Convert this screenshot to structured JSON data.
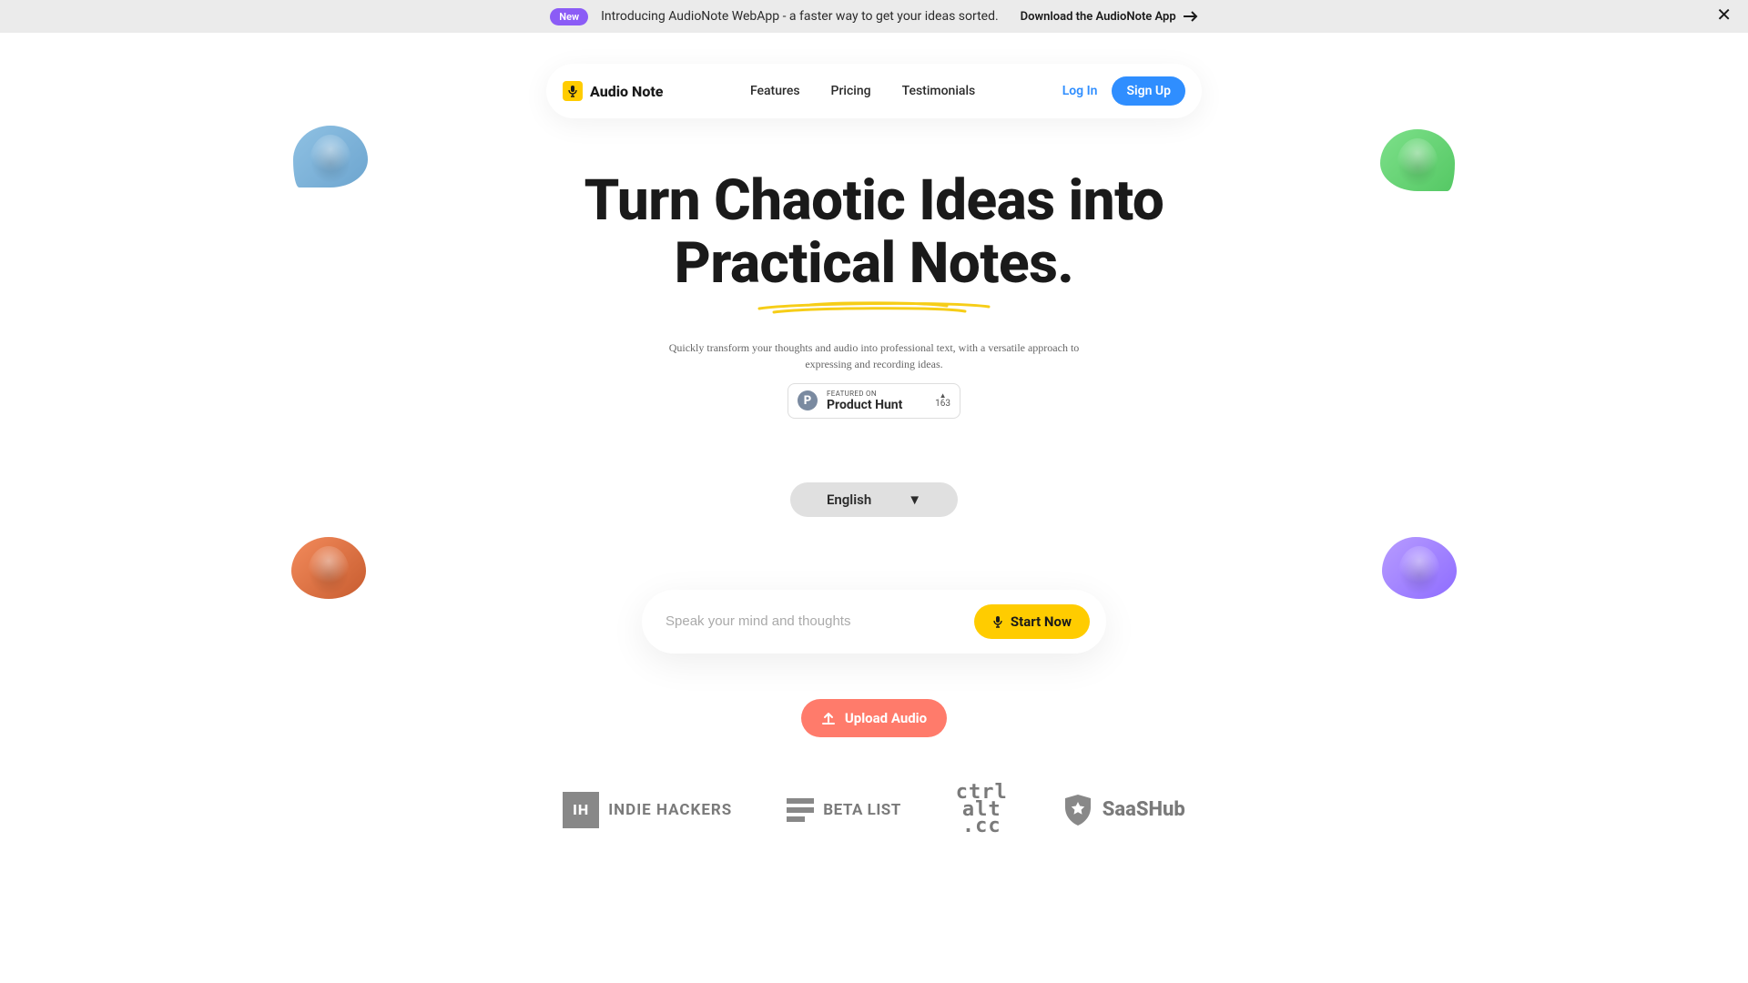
{
  "banner": {
    "badge": "New",
    "text": "Introducing AudioNote WebApp - a faster way to get your ideas sorted.",
    "link": "Download the AudioNote App"
  },
  "brand": {
    "name": "Audio Note"
  },
  "nav": {
    "items": [
      "Features",
      "Pricing",
      "Testimonials"
    ],
    "login": "Log In",
    "signup": "Sign Up"
  },
  "hero": {
    "line1": "Turn Chaotic Ideas into",
    "line2": "Practical Notes.",
    "subhead": "Quickly transform your thoughts and audio into professional text, with a versatile approach to expressing and recording ideas."
  },
  "product_hunt": {
    "small": "FEATURED ON",
    "big": "Product Hunt",
    "upvotes": "163"
  },
  "language": {
    "selected": "English"
  },
  "input": {
    "placeholder": "Speak your mind and thoughts",
    "start": "Start Now"
  },
  "upload": {
    "label": "Upload Audio"
  },
  "logos": {
    "ih": "INDIE HACKERS",
    "beta": "BETA LIST",
    "ctrl_l1": "ctrl",
    "ctrl_l2": "alt",
    "ctrl_l3": ".cc",
    "saas": "SaaSHub"
  }
}
